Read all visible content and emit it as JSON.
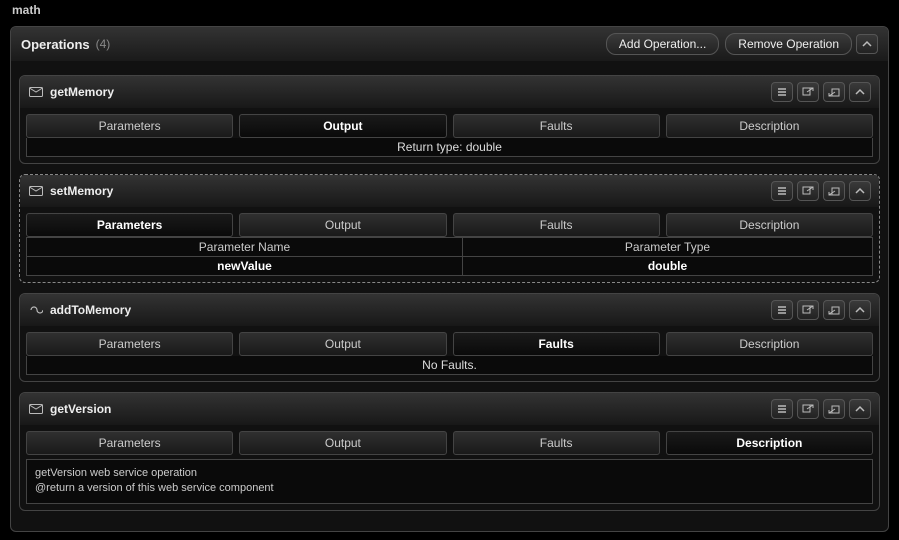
{
  "top_label": "math",
  "operations_panel": {
    "title": "Operations",
    "count": "(4)",
    "add_btn": "Add Operation...",
    "remove_btn": "Remove Operation"
  },
  "tabs": {
    "parameters": "Parameters",
    "output": "Output",
    "faults": "Faults",
    "description": "Description"
  },
  "ops": [
    {
      "name": "getMemory",
      "active_tab": "output",
      "output_text": "Return type:  double"
    },
    {
      "name": "setMemory",
      "active_tab": "parameters",
      "param_header_name": "Parameter Name",
      "param_header_type": "Parameter Type",
      "params": [
        {
          "name": "newValue",
          "type": "double"
        }
      ]
    },
    {
      "name": "addToMemory",
      "active_tab": "faults",
      "faults_text": "No Faults."
    },
    {
      "name": "getVersion",
      "active_tab": "description",
      "description_text": "getVersion web service operation\n@return a version of this web service component"
    }
  ]
}
